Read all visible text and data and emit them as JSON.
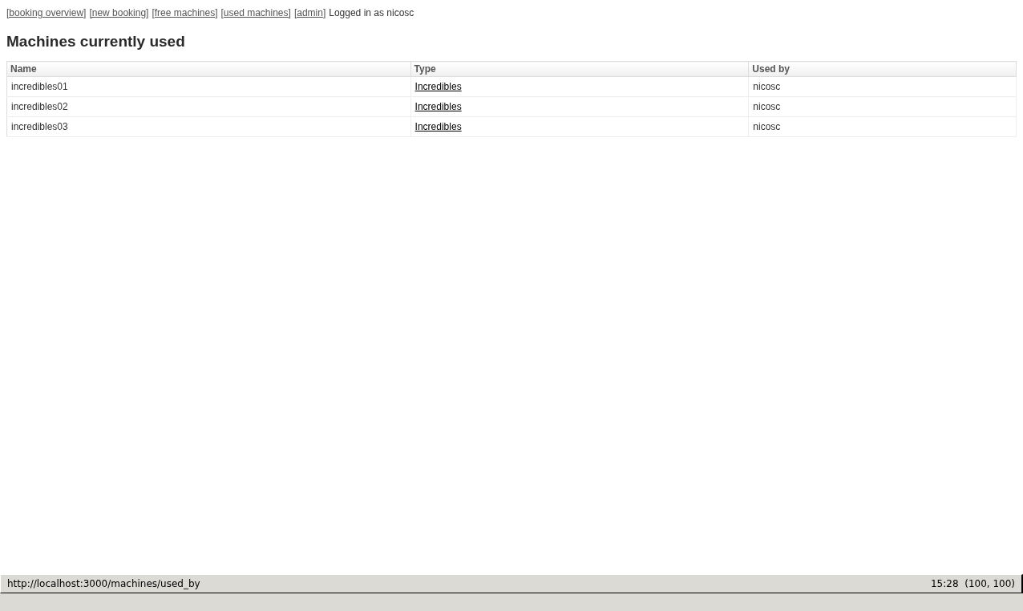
{
  "nav": {
    "links": [
      "[booking overview]",
      "[new booking]",
      "[free machines]",
      "[used machines]",
      "[admin]"
    ],
    "login_text": "Logged in as nicosc"
  },
  "heading": "Machines currently used",
  "table": {
    "columns": [
      "Name",
      "Type",
      "Used by"
    ],
    "rows": [
      {
        "name": "incredibles01",
        "type": "Incredibles",
        "used_by": "nicosc"
      },
      {
        "name": "incredibles02",
        "type": "Incredibles",
        "used_by": "nicosc"
      },
      {
        "name": "incredibles03",
        "type": "Incredibles",
        "used_by": "nicosc"
      }
    ]
  },
  "status_bar": {
    "url": "http://localhost:3000/machines/used_by",
    "info": "15:28  (100, 100)"
  }
}
